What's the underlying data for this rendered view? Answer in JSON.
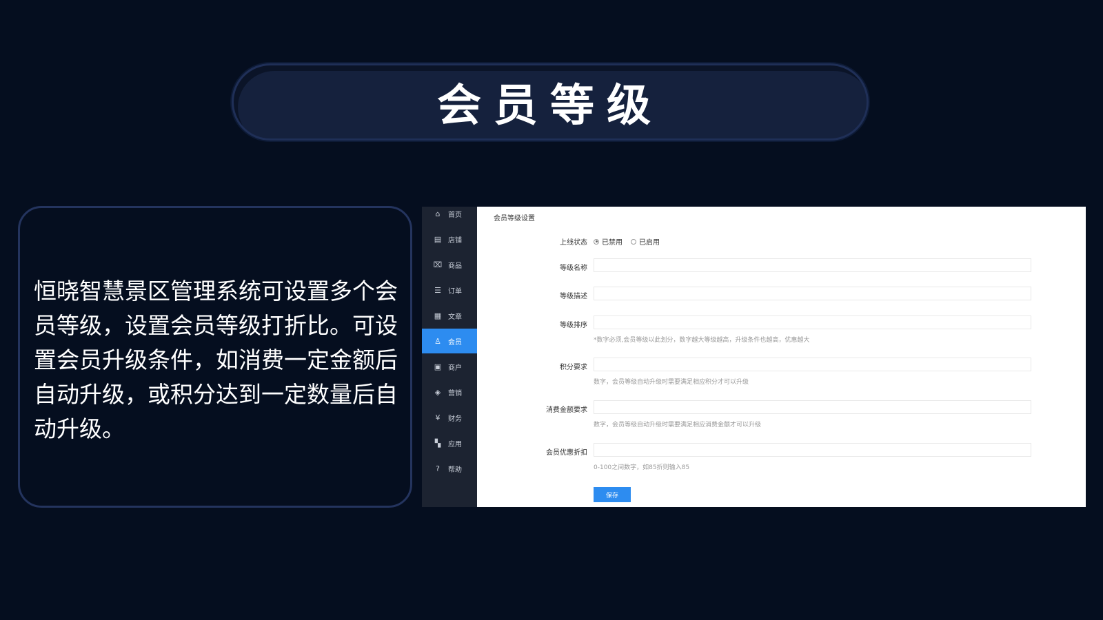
{
  "slide": {
    "title": "会员等级",
    "description": "恒晓智慧景区管理系统可设置多个会员等级，设置会员等级打折比。可设置会员升级条件，如消费一定金额后自动升级，或积分达到一定数量后自动升级。"
  },
  "sidebar": {
    "items": [
      {
        "label": "首页",
        "icon": "home-icon"
      },
      {
        "label": "店铺",
        "icon": "store-icon"
      },
      {
        "label": "商品",
        "icon": "bag-icon"
      },
      {
        "label": "订单",
        "icon": "order-icon"
      },
      {
        "label": "文章",
        "icon": "document-icon"
      },
      {
        "label": "会员",
        "icon": "user-icon",
        "active": true
      },
      {
        "label": "商户",
        "icon": "merchant-icon"
      },
      {
        "label": "营销",
        "icon": "marketing-icon"
      },
      {
        "label": "财务",
        "icon": "yen-icon"
      },
      {
        "label": "应用",
        "icon": "apps-icon"
      },
      {
        "label": "帮助",
        "icon": "help-icon"
      }
    ],
    "active_color": "#2d8cf0"
  },
  "form": {
    "section_title": "会员等级设置",
    "status": {
      "label": "上线状态",
      "options": [
        "已禁用",
        "已启用"
      ],
      "selected": "已禁用"
    },
    "level_name": {
      "label": "等级名称",
      "value": ""
    },
    "level_desc": {
      "label": "等级描述",
      "value": ""
    },
    "level_sort": {
      "label": "等级排序",
      "value": "",
      "hint": "*数字必须,会员等级以此划分，数字越大等级越高，升级条件也越高，优惠越大"
    },
    "points_req": {
      "label": "积分要求",
      "value": "",
      "hint": "数字，会员等级自动升级时需要满足相应积分才可以升级"
    },
    "spend_req": {
      "label": "消费金额要求",
      "value": "",
      "hint": "数字，会员等级自动升级时需要满足相应消费金额才可以升级"
    },
    "discount": {
      "label": "会员优惠折扣",
      "value": "",
      "hint": "0-100之间数字，如85折则输入85"
    },
    "save_label": "保存"
  }
}
